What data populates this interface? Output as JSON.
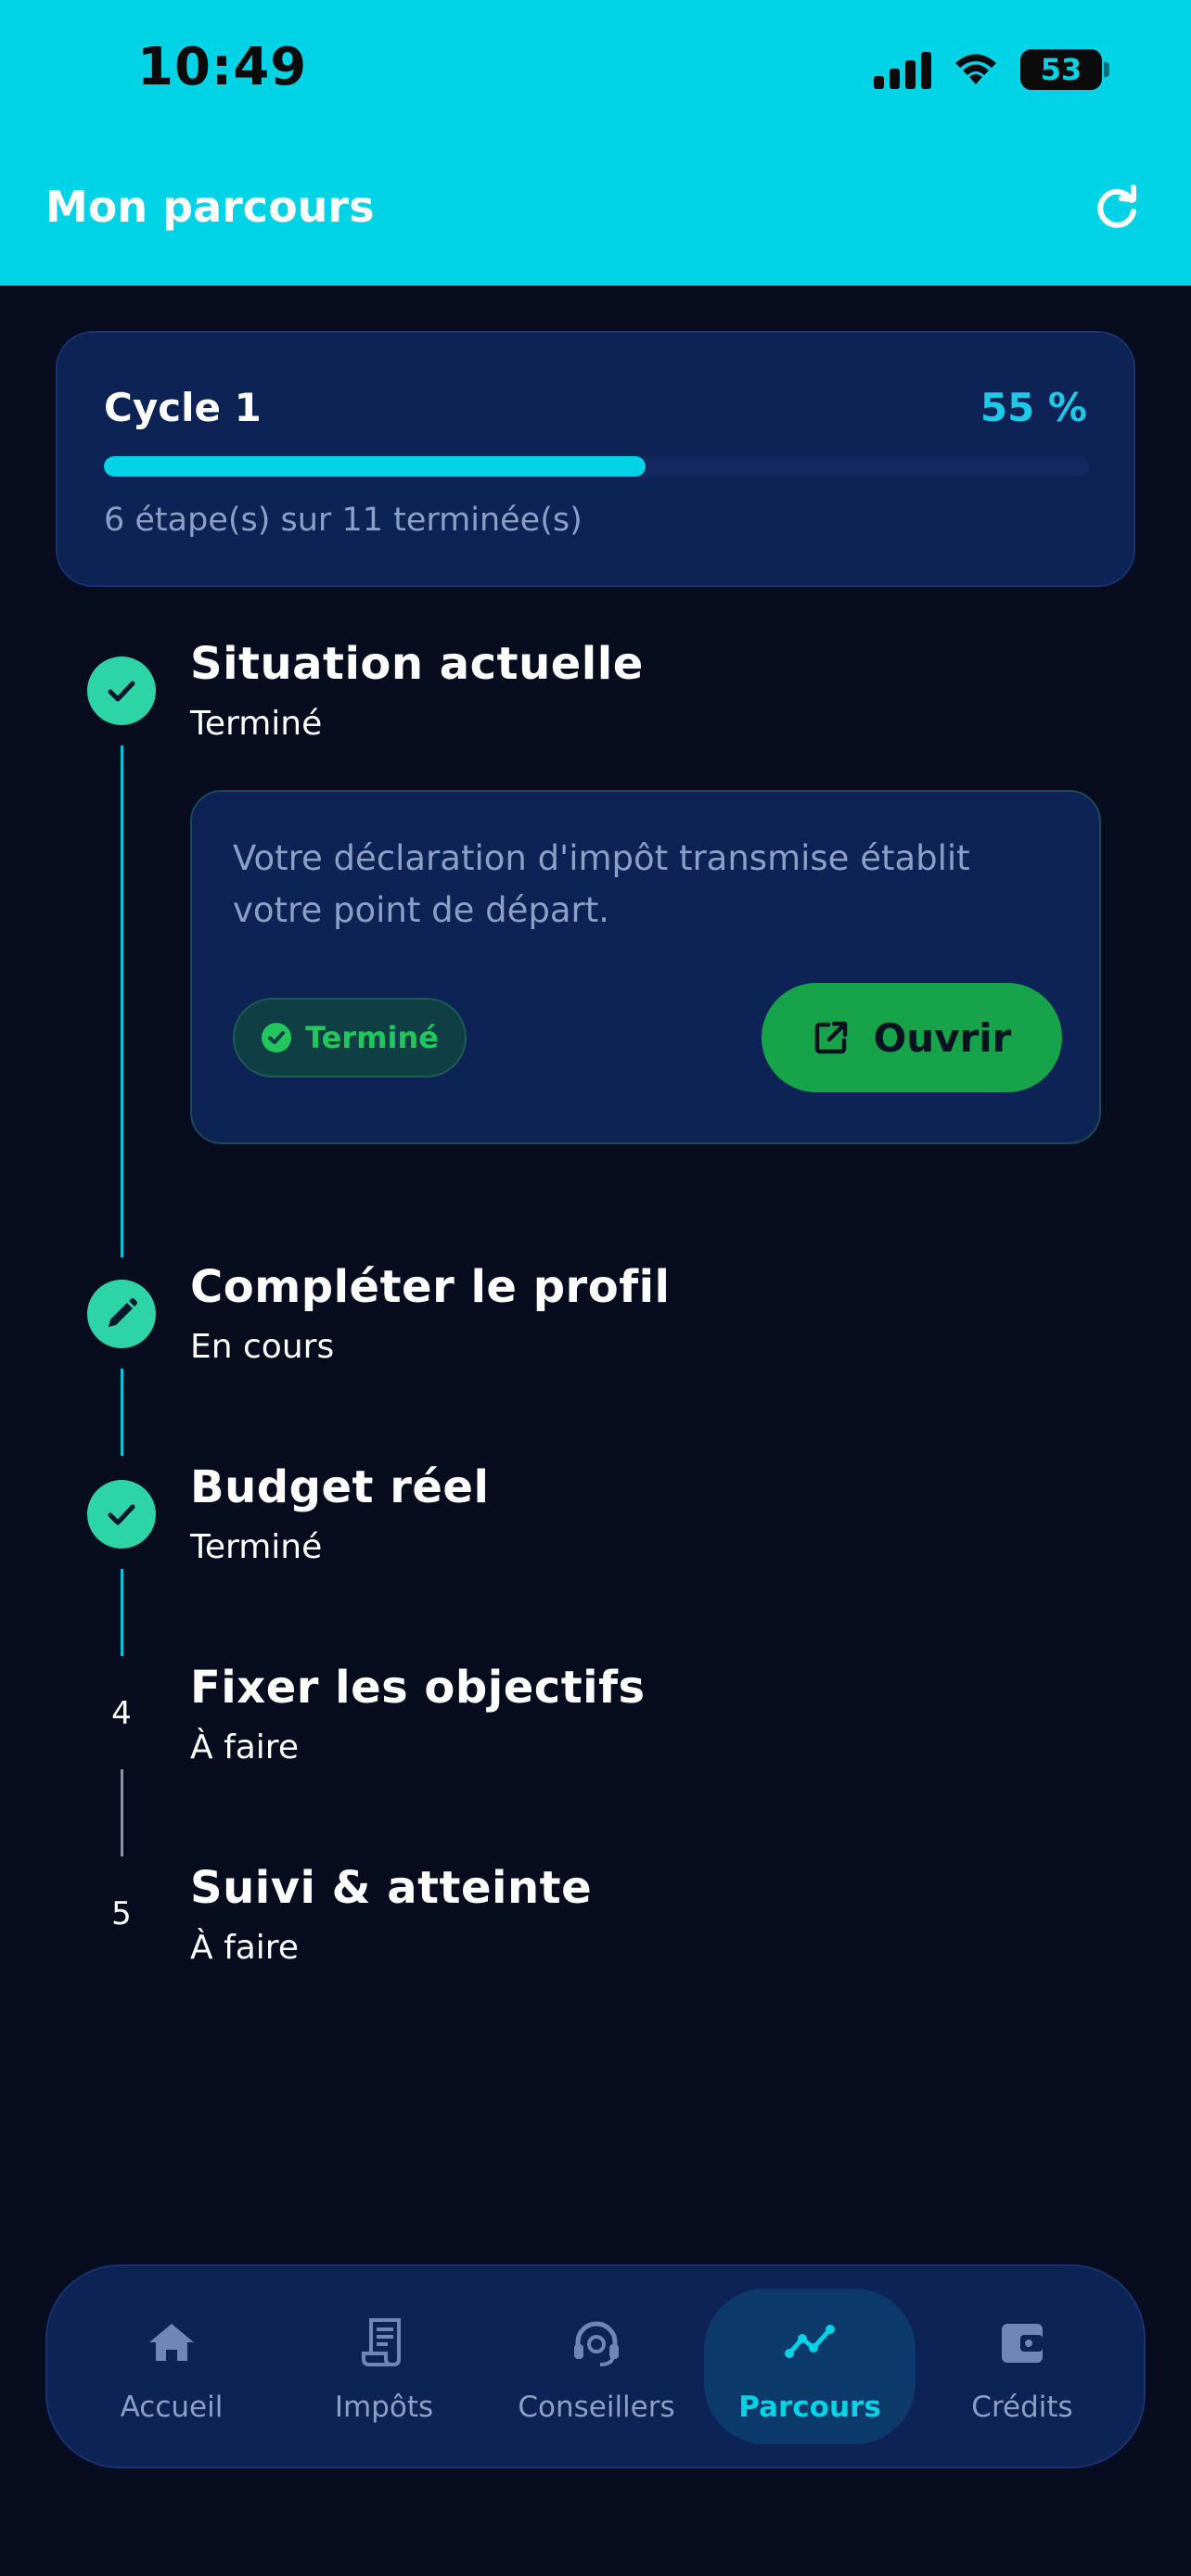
{
  "status_bar": {
    "time": "10:49",
    "battery": "53"
  },
  "header": {
    "title": "Mon parcours"
  },
  "cycle": {
    "title": "Cycle 1",
    "percent_label": "55 %",
    "progress": 0.55,
    "summary": "6 étape(s) sur 11 terminée(s)"
  },
  "steps": [
    {
      "title": "Situation actuelle",
      "status": "Terminé",
      "marker": "check-icon"
    },
    {
      "title": "Compléter le profil",
      "status": "En cours",
      "marker": "pencil-icon"
    },
    {
      "title": "Budget réel",
      "status": "Terminé",
      "marker": "check-icon"
    },
    {
      "title": "Fixer les objectifs",
      "status": "À faire",
      "number": "4"
    },
    {
      "title": "Suivi & atteinte",
      "status": "À faire",
      "number": "5"
    }
  ],
  "detail_card": {
    "description": "Votre déclaration d'impôt transmise établit votre point de départ.",
    "chip_label": "Terminé",
    "open_label": "Ouvrir"
  },
  "nav": {
    "items": [
      {
        "label": "Accueil",
        "icon": "home-icon"
      },
      {
        "label": "Impôts",
        "icon": "receipt-icon"
      },
      {
        "label": "Conseillers",
        "icon": "headset-icon"
      },
      {
        "label": "Parcours",
        "icon": "trend-icon",
        "active": true
      },
      {
        "label": "Crédits",
        "icon": "wallet-icon"
      }
    ]
  },
  "colors": {
    "header": "#00d3e6",
    "background": "#070d1f",
    "card": "#0e2355",
    "accent": "#00d3e6",
    "success": "#2dd4a6",
    "button_green": "#16a34a"
  }
}
